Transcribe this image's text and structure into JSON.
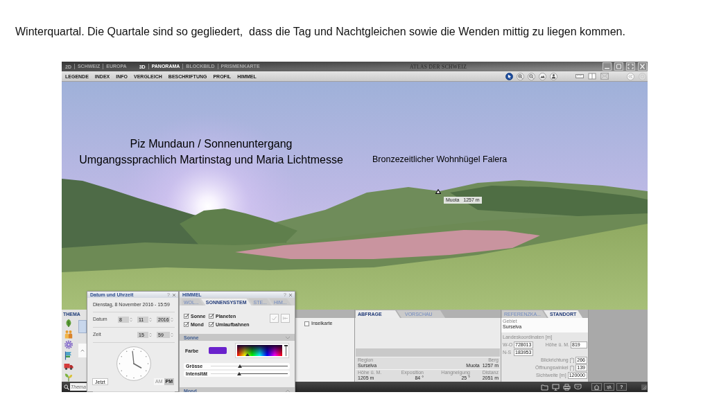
{
  "caption": "Winterquartal. Die Quartale sind so gegliedert,  dass die Tag und Nachtgleichen sowie die Wenden mittig zu liegen kommen.",
  "app": {
    "title": "ATLAS DER SCHWEIZ",
    "view_modes": [
      {
        "label": "2D",
        "selected": false,
        "items": [
          {
            "label": "SCHWEIZ",
            "selected": false
          },
          {
            "label": "EUROPA",
            "selected": false
          }
        ]
      },
      {
        "label": "3D",
        "selected": true,
        "items": [
          {
            "label": "PANORAMA",
            "selected": true
          },
          {
            "label": "BLOCKBILD",
            "selected": false
          },
          {
            "label": "PRISMENKARTE",
            "selected": false
          }
        ]
      }
    ],
    "menu": [
      "LEGENDE",
      "INDEX",
      "INFO",
      "VERGLEICH",
      "BESCHRIFTUNG",
      "PROFIL",
      "HIMMEL"
    ],
    "tools": [
      {
        "selected": true
      },
      {
        "selected": false
      },
      {
        "selected": false
      },
      {
        "selected": false
      },
      {
        "selected": false
      }
    ],
    "view": {
      "annotation": [
        "Piz Mundaun / Sonnenuntergang",
        "Umgangssprachlich Martinstag und Maria Lichtmesse"
      ],
      "place_label": "Bronzezeitlicher Wohnhügel Falera",
      "peak_label": "Muota   1257 m"
    },
    "thema": {
      "title": "THEMA"
    },
    "island_map": {
      "label": "Inselkarte",
      "checked": false
    },
    "query_panel": {
      "tabs": [
        {
          "label": "ABFRAGE",
          "selected": true
        },
        {
          "label": "VORSCHAU",
          "selected": false
        }
      ],
      "results": [
        [
          {
            "label": "Region",
            "value": "Surselva"
          },
          {
            "label": "Berg",
            "value": "Muota  1257 m"
          }
        ],
        [
          {
            "label": "Höhe ü. M.",
            "value": "1205 m"
          },
          {
            "label": "Exposition",
            "value": "84 °"
          },
          {
            "label": "Hangneigung",
            "value": "25 °"
          },
          {
            "label": "Distanz",
            "value": "2051 m"
          }
        ]
      ]
    },
    "location_panel": {
      "tabs": [
        {
          "label": "REFERENZKA...",
          "selected": false
        },
        {
          "label": "STANDORT",
          "selected": true
        }
      ],
      "area": {
        "label": "Gebiet",
        "value": "Surselva"
      },
      "coords_title": "Landeskoordinaten [m]",
      "coords": [
        {
          "label": "W-O",
          "value": "728013"
        },
        {
          "label": "N-S",
          "value": "183953"
        }
      ],
      "altitude": {
        "label": "Höhe ü. M.",
        "value": "819"
      },
      "view_params": [
        {
          "label": "Blickrichtung [°]",
          "value": "266"
        },
        {
          "label": "Öffnungswinkel [°]",
          "value": "139"
        },
        {
          "label": "Sichtweite [m]",
          "value": "120000"
        }
      ]
    },
    "date_window": {
      "title": "Datum und Uhrzeit",
      "help": "?",
      "summary": "Dienstag, 8 November 2016 - 15:59",
      "date_label": "Datum",
      "day": "8",
      "month": "11",
      "year": "2016",
      "time_label": "Zeit",
      "hour": "15",
      "minute": "59",
      "now_button": "Jetzt",
      "meridiem": [
        {
          "label": "AM",
          "selected": false
        },
        {
          "label": "PM",
          "selected": true
        }
      ]
    },
    "sky_window": {
      "title": "HIMMEL",
      "help": "?",
      "tabs": [
        {
          "label": "WOL...",
          "selected": false
        },
        {
          "label": "SONNENSYSTEM",
          "selected": true
        },
        {
          "label": "STE...",
          "selected": false
        },
        {
          "label": "HIM...",
          "selected": false
        }
      ],
      "options": [
        {
          "label": "Sonne",
          "checked": true
        },
        {
          "label": "Planeten",
          "checked": true
        },
        {
          "label": "Mond",
          "checked": true
        },
        {
          "label": "Umlaufbahnen",
          "checked": true
        }
      ],
      "sections": [
        {
          "title": "Sonne",
          "expanded": true,
          "color_label": "Farbe",
          "color": "#6a22cc",
          "brightness": {
            "level": 1
          },
          "sliders": [
            {
              "label": "Grösse",
              "level": 0.38
            },
            {
              "label": "Intensität",
              "level": 0.37
            }
          ]
        },
        {
          "title": "Mond",
          "expanded": false
        }
      ]
    },
    "status_bar": {
      "search_placeholder": "Thema",
      "help": "?"
    }
  }
}
